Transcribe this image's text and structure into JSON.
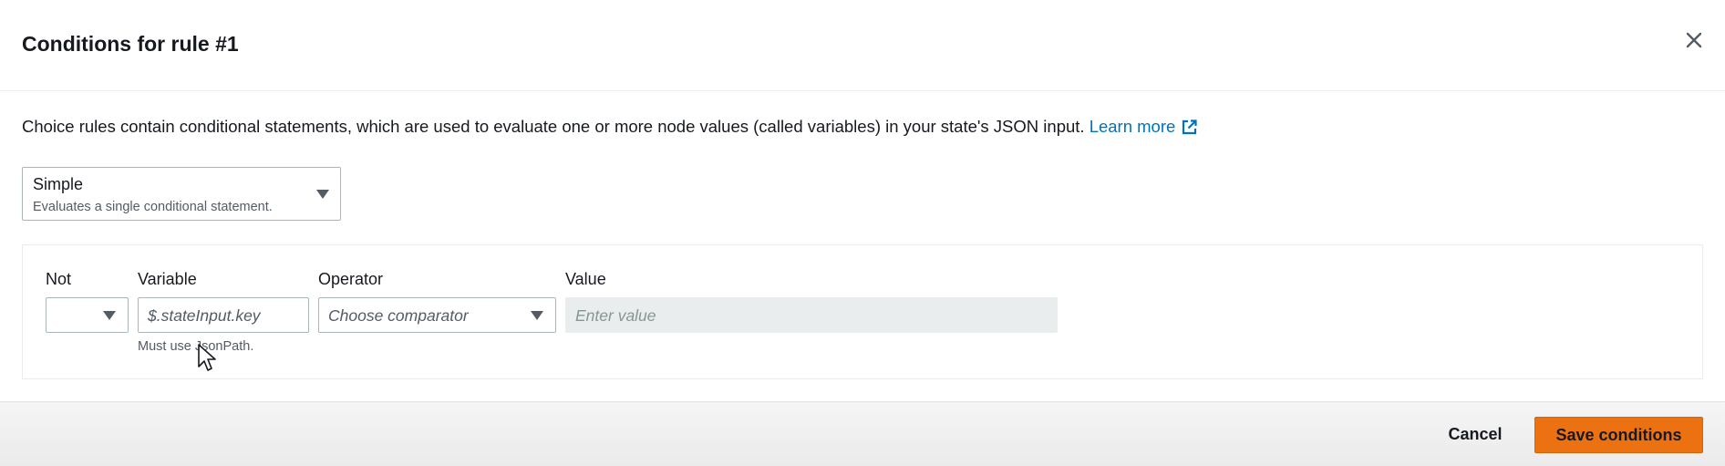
{
  "modal": {
    "title": "Conditions for rule #1",
    "close_icon": "close-icon"
  },
  "description": {
    "text": "Choice rules contain conditional statements, which are used to evaluate one or more node values (called variables) in your state's JSON input. ",
    "link_label": "Learn more",
    "link_icon": "external-link-icon"
  },
  "mode_select": {
    "value": "Simple",
    "description": "Evaluates a single conditional statement."
  },
  "condition": {
    "not": {
      "label": "Not",
      "value": ""
    },
    "variable": {
      "label": "Variable",
      "placeholder": "$.stateInput.key",
      "hint": "Must use JsonPath."
    },
    "operator": {
      "label": "Operator",
      "placeholder": "Choose comparator"
    },
    "value": {
      "label": "Value",
      "placeholder": "Enter value"
    }
  },
  "footer": {
    "cancel_label": "Cancel",
    "save_label": "Save conditions"
  },
  "colors": {
    "primary_button": "#ec7211",
    "link": "#0073bb",
    "text": "#16191f",
    "muted_text": "#545b64"
  }
}
